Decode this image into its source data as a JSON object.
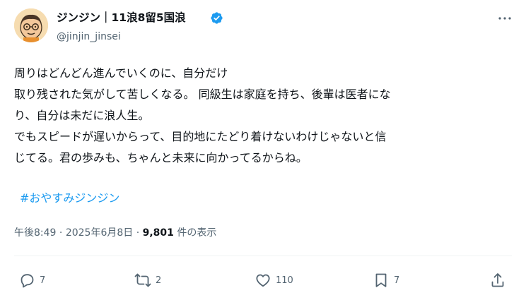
{
  "author": {
    "display_name": "ジンジン｜11浪8留5国浪",
    "handle": "@jinjin_jinsei",
    "verified": true
  },
  "tweet": {
    "lines": [
      "周りはどんどん進んでいくのに、自分だけ",
      "取り残された気がして苦しくなる。 同級生は家庭を持ち、後輩は医者にな",
      "り、自分は未だに浪人生。",
      "でもスピードが遅いからって、目的地にたどり着けないわけじゃないと信",
      "じてる。君の歩みも、ちゃんと未来に向かってるからね。"
    ],
    "hashtag": "#おやすみジンジン"
  },
  "meta": {
    "time": "午後8:49",
    "separator": "·",
    "date": "2025年6月8日",
    "views": "9,801",
    "views_label": "件の表示"
  },
  "actions": {
    "replies": "7",
    "reposts": "2",
    "likes": "110",
    "bookmarks": "7"
  },
  "colors": {
    "link": "#1d9bf0",
    "secondary_text": "#536471",
    "verified": "#1d9bf0"
  },
  "icons": [
    "avatar-illustration",
    "verified-badge-icon",
    "more-icon",
    "reply-icon",
    "repost-icon",
    "like-icon",
    "bookmark-icon",
    "share-icon"
  ]
}
